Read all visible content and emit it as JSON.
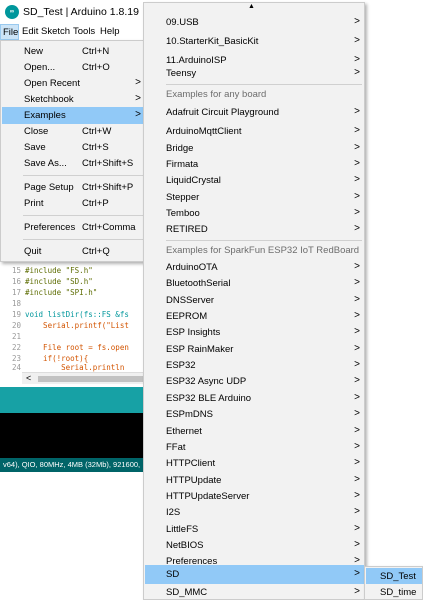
{
  "window": {
    "title": "SD_Test | Arduino 1.8.19",
    "icon": "arduino-logo-icon"
  },
  "menubar": [
    "File",
    "Edit",
    "Sketch",
    "Tools",
    "Help"
  ],
  "file_menu": {
    "items": [
      {
        "label": "New",
        "shortcut": "Ctrl+N"
      },
      {
        "label": "Open...",
        "shortcut": "Ctrl+O"
      },
      {
        "label": "Open Recent",
        "shortcut": ""
      },
      {
        "label": "Sketchbook",
        "shortcut": ""
      },
      {
        "label": "Examples",
        "shortcut": ""
      },
      {
        "label": "Close",
        "shortcut": "Ctrl+W"
      },
      {
        "label": "Save",
        "shortcut": "Ctrl+S"
      },
      {
        "label": "Save As...",
        "shortcut": "Ctrl+Shift+S"
      },
      {
        "label": "Page Setup",
        "shortcut": "Ctrl+Shift+P"
      },
      {
        "label": "Print",
        "shortcut": "Ctrl+P"
      },
      {
        "label": "Preferences",
        "shortcut": "Ctrl+Comma"
      },
      {
        "label": "Quit",
        "shortcut": "Ctrl+Q"
      }
    ],
    "highlighted": "Examples"
  },
  "editor": {
    "lines": [
      {
        "num": "15",
        "code": "#include \"FS.h\""
      },
      {
        "num": "16",
        "code": "#include \"SD.h\""
      },
      {
        "num": "17",
        "code": "#include \"SPI.h\""
      },
      {
        "num": "18",
        "code": ""
      },
      {
        "num": "19",
        "code": "void listDir(fs::FS &fs"
      },
      {
        "num": "20",
        "code": "    Serial.printf(\"List"
      },
      {
        "num": "21",
        "code": ""
      },
      {
        "num": "22",
        "code": "    File root = fs.open"
      },
      {
        "num": "23",
        "code": "    if(!root){"
      },
      {
        "num": "24",
        "code": "        Serial.println"
      }
    ]
  },
  "status_bar": "v64), QIO, 80MHz, 4MB (32Mb), 921600,",
  "examples_menu": {
    "top_items": [
      "09.USB",
      "10.StarterKit_BasicKit",
      "11.ArduinoISP",
      "Teensy"
    ],
    "any_board_header": "Examples for any board",
    "any_board_items": [
      "Adafruit Circuit Playground",
      "ArduinoMqttClient",
      "Bridge",
      "Firmata",
      "LiquidCrystal",
      "Stepper",
      "Temboo",
      "RETIRED"
    ],
    "board_header": "Examples for SparkFun ESP32 IoT RedBoard",
    "board_items": [
      "ArduinoOTA",
      "BluetoothSerial",
      "DNSServer",
      "EEPROM",
      "ESP Insights",
      "ESP RainMaker",
      "ESP32",
      "ESP32 Async UDP",
      "ESP32 BLE Arduino",
      "ESPmDNS",
      "Ethernet",
      "FFat",
      "HTTPClient",
      "HTTPUpdate",
      "HTTPUpdateServer",
      "I2S",
      "LittleFS",
      "NetBIOS",
      "Preferences",
      "SD",
      "SD_MMC"
    ],
    "highlighted": "SD"
  },
  "sd_submenu": {
    "items": [
      "SD_Test",
      "SD_time"
    ],
    "highlighted": "SD_Test"
  },
  "colors": {
    "accent_highlight": "#91c9f7",
    "arduino_teal": "#00979c",
    "toolbar_dark": "#006468"
  }
}
